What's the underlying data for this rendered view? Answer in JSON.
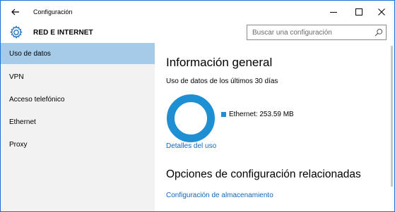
{
  "window": {
    "title": "Configuración"
  },
  "header": {
    "section_title": "RED E INTERNET",
    "search_placeholder": "Buscar una configuración"
  },
  "sidebar": {
    "items": [
      {
        "label": "Uso de datos",
        "active": true
      },
      {
        "label": "VPN",
        "active": false
      },
      {
        "label": "Acceso telefónico",
        "active": false
      },
      {
        "label": "Ethernet",
        "active": false
      },
      {
        "label": "Proxy",
        "active": false
      }
    ]
  },
  "main": {
    "heading": "Información general",
    "usage_caption": "Uso de datos de los últimos 30 días",
    "legend_label": "Ethernet: 253.59 MB",
    "details_link": "Detalles del uso",
    "related_heading": "Opciones de configuración relacionadas",
    "storage_link": "Configuración de almacenamiento"
  },
  "colors": {
    "accent": "#1e8fd3",
    "active_item": "#a6cbe8",
    "sidebar_bg": "#f2f2f2",
    "link": "#1266b8"
  },
  "icons": [
    "back-arrow-icon",
    "minimize-icon",
    "maximize-icon",
    "close-icon",
    "gear-icon",
    "search-icon"
  ]
}
